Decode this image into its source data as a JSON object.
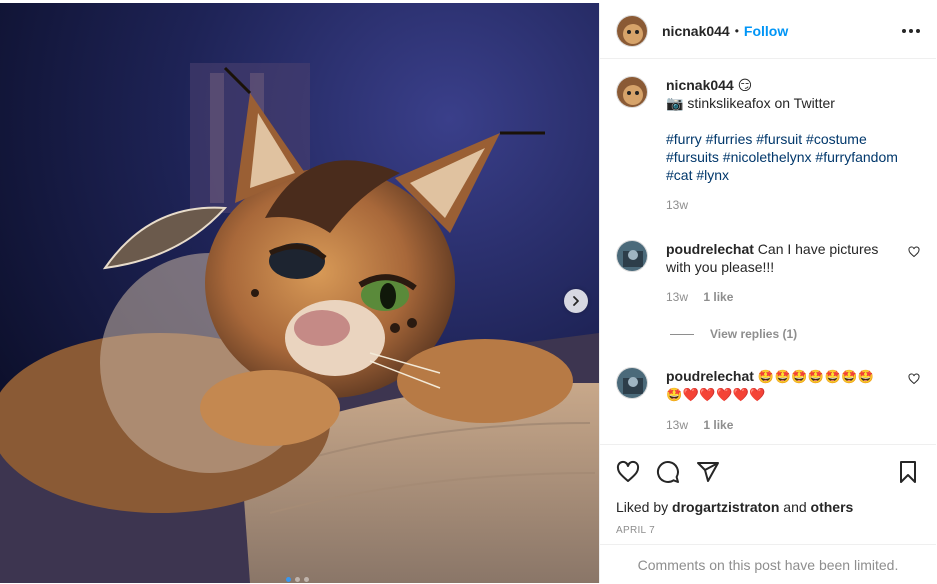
{
  "post": {
    "username": "nicnak044",
    "separator": "•",
    "follow_label": "Follow",
    "caption_emoji": "😏",
    "caption_line1": "📷 stinkslikeafox on Twitter",
    "hashtags_line1": "#furry #furries #fursuit #costume",
    "hashtags_line2": "#fursuits #nicolethelynx #furryfandom",
    "hashtags_line3": "#cat #lynx",
    "caption_time": "13w",
    "carousel": {
      "slides": 3,
      "active": 1
    }
  },
  "comments": [
    {
      "username": "poudrelechat",
      "text": "Can I have pictures",
      "text_line2": "with you please!!!",
      "time": "13w",
      "likes": "1 like",
      "view_replies": "View replies (1)"
    },
    {
      "username": "poudrelechat",
      "emoji_line1": "🤩🤩🤩🤩🤩🤩🤩",
      "emoji_line2": "🤩❤️❤️❤️❤️❤️",
      "time": "13w",
      "likes": "1 like"
    }
  ],
  "footer": {
    "liked_by_prefix": "Liked by",
    "liked_by_user": "drogartzistraton",
    "and": "and",
    "others": "others",
    "date": "APRIL 7",
    "comments_limited": "Comments on this post have been limited."
  },
  "colors": {
    "link": "#0095f6",
    "hashtag": "#00376b",
    "muted": "#8e8e8e",
    "text": "#262626"
  },
  "icons": [
    "more-options-icon",
    "heart-icon",
    "comment-icon",
    "share-icon",
    "bookmark-icon",
    "chevron-right-icon"
  ]
}
